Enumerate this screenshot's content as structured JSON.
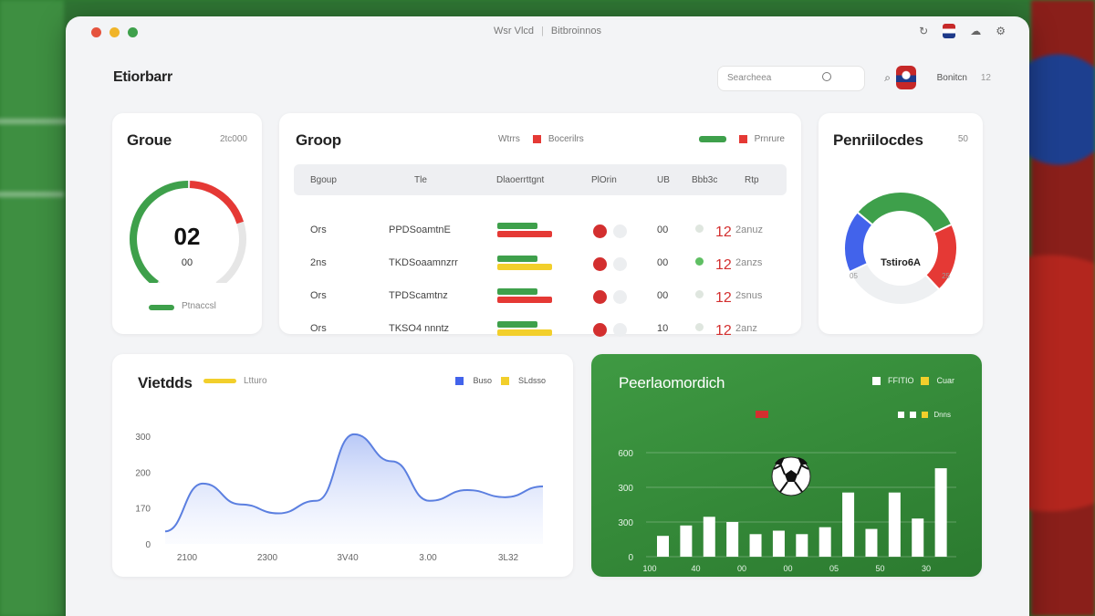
{
  "window": {
    "title_left": "Wsr Vlcd",
    "title_right": "Bitbroinnos"
  },
  "app": {
    "brand": "Etiorbarr",
    "search_placeholder": "Searcheea",
    "username": "Bonitcn",
    "user_count": "12"
  },
  "gauge_card": {
    "title": "Groue",
    "subtitle": "2tc000",
    "value": "02",
    "sub_value": "00",
    "legend_label": "Ptnaccsl",
    "gauge_green_fraction": 0.5,
    "gauge_red_fraction": 0.25,
    "colors": {
      "green": "#3ea04b",
      "red": "#e53935",
      "track": "#e6e6e6"
    }
  },
  "group_card": {
    "title": "Groop",
    "legend_a_label": "Wtrrs",
    "legend_b_label": "Bocerilrs",
    "legend_c_label": "Prnrure",
    "columns": [
      "Bgoup",
      "Tle",
      "Dlaoerrttgnt",
      "PlOrin",
      "UB",
      "Bbb3c",
      "Rtp"
    ],
    "rows": [
      {
        "group": "Ors",
        "team": "PPDSoamtnE",
        "bar_top": "#3ea04b",
        "bar_bottom": "#e53935",
        "val": "00",
        "dot": "#dfe6df",
        "score": "12",
        "note": "2anuz"
      },
      {
        "group": "2ns",
        "team": "TKDSoaamnzrr",
        "bar_top": "#3ea04b",
        "bar_bottom": "#f2cf2b",
        "val": "00",
        "dot": "#5fbf63",
        "score": "12",
        "note": "2anzs"
      },
      {
        "group": "Ors",
        "team": "TPDScamtnz",
        "bar_top": "#3ea04b",
        "bar_bottom": "#e53935",
        "val": "00",
        "dot": "#dfe6df",
        "score": "12",
        "note": "2snus"
      },
      {
        "group": "Ors",
        "team": "TKSO4 nnntz",
        "bar_top": "#3ea04b",
        "bar_bottom": "#f2cf2b",
        "val": "10",
        "dot": "#dfe6df",
        "score": "12",
        "note": "2anz"
      }
    ]
  },
  "donut_card": {
    "title": "Penriilocdes",
    "subtitle": "50",
    "center_label": "Tstiro6A",
    "left_label": "05",
    "right_label": "25",
    "segments": [
      {
        "color": "#4263eb",
        "fraction": 0.18
      },
      {
        "color": "#3ea04b",
        "fraction": 0.32
      },
      {
        "color": "#e53935",
        "fraction": 0.2
      },
      {
        "color": "#eef0f2",
        "fraction": 0.3
      }
    ]
  },
  "line_card": {
    "title": "Vietdds",
    "legend_left": "Ltturo",
    "legend_blue": "Buso",
    "legend_yellow": "SLdsso",
    "colors": {
      "line": "#5b7fe0",
      "blue": "#4263eb",
      "yellow": "#f2cf2b"
    }
  },
  "bar_card": {
    "title": "Peerlaomordich",
    "legend_a": "FFITIO",
    "legend_b": "Cuar",
    "legend_c": "Dnns"
  },
  "chart_data": [
    {
      "type": "area",
      "title": "Vietdds",
      "ytick_labels": [
        "0",
        "170",
        "200",
        "300"
      ],
      "xtick_labels": [
        "2100",
        "2300",
        "3V40",
        "3.00",
        "3L32"
      ],
      "y_axis_values": [
        0,
        100,
        200,
        300
      ],
      "x": [
        0,
        1,
        2,
        3,
        4,
        5,
        6,
        7,
        8,
        9,
        10
      ],
      "values": [
        35,
        168,
        110,
        85,
        120,
        305,
        230,
        120,
        150,
        130,
        160
      ],
      "ylim": [
        0,
        320
      ]
    },
    {
      "type": "bar",
      "title": "Peerlaomordich",
      "ytick_labels": [
        "0",
        "300",
        "300",
        "600"
      ],
      "xtick_labels": [
        "100",
        "40",
        "00",
        "00",
        "05",
        "50",
        "30"
      ],
      "y_axis_values": [
        0,
        100,
        200,
        300
      ],
      "values": [
        60,
        90,
        115,
        100,
        65,
        75,
        65,
        85,
        185,
        80,
        185,
        110,
        255
      ],
      "ylim": [
        0,
        300
      ]
    }
  ]
}
